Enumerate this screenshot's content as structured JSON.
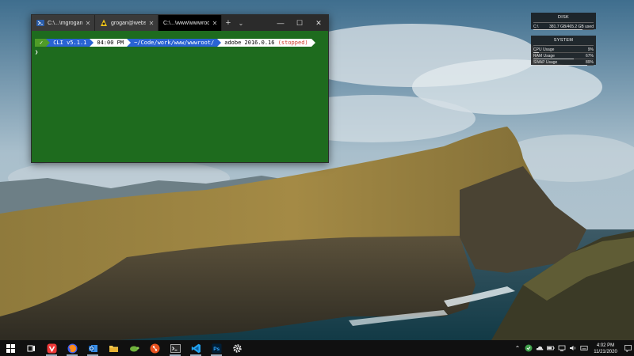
{
  "terminal": {
    "tabs": [
      {
        "label": "C:\\...\\mgrogan.c",
        "icon": "powershell-icon",
        "active": false
      },
      {
        "label": "grogan@webse",
        "icon": "linux-penguin-icon",
        "active": false
      },
      {
        "label": "C:\\...\\www\\wwwroot",
        "icon": "none",
        "active": true
      }
    ],
    "new_tab": "+",
    "dropdown": "⌄",
    "controls": {
      "minimize": "—",
      "maximize": "☐",
      "close": "✕"
    },
    "prompt": {
      "check": "✓",
      "cli": "CLI v5.1.1",
      "time": "04:00 PM",
      "path": "~/Code/work/www/wwwroot/",
      "env_name": "adobe 2016.0.16",
      "env_status": "(stopped)",
      "caret": "❯"
    },
    "background_color": "#1e6b1e"
  },
  "widgets": {
    "disk": {
      "title": "DISK",
      "drive": "C:\\",
      "usage": "381.7 GB/465.2 GB used",
      "fraction": 0.82
    },
    "system": {
      "title": "SYSTEM",
      "rows": [
        {
          "label": "CPU Usage",
          "value": "9%",
          "fraction": 0.09
        },
        {
          "label": "RAM Usage",
          "value": "67%",
          "fraction": 0.67
        },
        {
          "label": "SWAP Usage",
          "value": "89%",
          "fraction": 0.89
        }
      ]
    }
  },
  "taskbar": {
    "apps": [
      {
        "name": "start-button",
        "icon": "windows-logo-icon"
      },
      {
        "name": "task-view-button",
        "icon": "task-view-icon"
      },
      {
        "name": "vivaldi-button",
        "icon": "vivaldi-icon"
      },
      {
        "name": "firefox-button",
        "icon": "firefox-icon"
      },
      {
        "name": "outlook-button",
        "icon": "outlook-icon"
      },
      {
        "name": "file-explorer-button",
        "icon": "folder-icon"
      },
      {
        "name": "sourcetree-button",
        "icon": "turtle-icon"
      },
      {
        "name": "git-button",
        "icon": "git-icon"
      },
      {
        "name": "terminal-button",
        "icon": "terminal-icon"
      },
      {
        "name": "vscode-button",
        "icon": "vscode-icon"
      },
      {
        "name": "photoshop-button",
        "icon": "photoshop-icon"
      },
      {
        "name": "settings-button",
        "icon": "gear-icon"
      }
    ],
    "photoshop_label": "Ps",
    "tray": {
      "chevron": "⌃",
      "time": "4:02 PM",
      "date": "11/21/2020"
    }
  }
}
